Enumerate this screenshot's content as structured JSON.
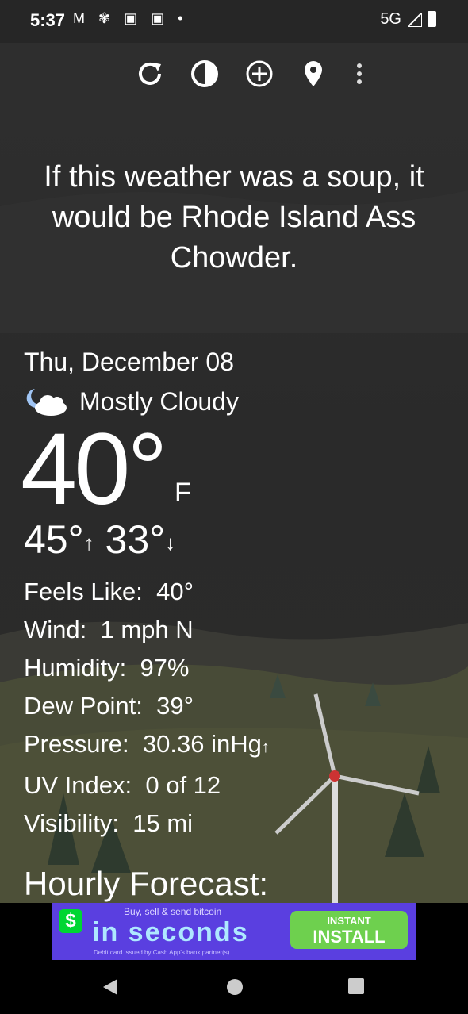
{
  "status": {
    "time": "5:37",
    "notif_icons": "M ✾ ▣ ▣ •",
    "network": "5G"
  },
  "toolbar": {
    "icons": [
      "refresh-icon",
      "theme-icon",
      "add-location-icon",
      "location-pin-icon",
      "more-vert-icon"
    ]
  },
  "headline": "If this weather was a soup, it would be Rhode Island Ass Chowder.",
  "weather": {
    "date": "Thu, December 08",
    "condition": "Mostly Cloudy",
    "temp": "40°",
    "unit": "F",
    "high": "45°",
    "low": "33°",
    "feels_like_label": "Feels Like:",
    "feels_like": "40°",
    "wind_label": "Wind:",
    "wind": "1 mph N",
    "humidity_label": "Humidity:",
    "humidity": "97%",
    "dew_point_label": "Dew Point:",
    "dew_point": "39°",
    "pressure_label": "Pressure:",
    "pressure": "30.36 inHg",
    "uv_label": "UV Index:",
    "uv": "0 of 12",
    "visibility_label": "Visibility:",
    "visibility": "15 mi"
  },
  "hourly_title": "Hourly Forecast:",
  "ad": {
    "top_text": "Buy, sell & send bitcoin",
    "main_text": "in seconds",
    "small_text": "Debit card issued by Cash App's bank partner(s).",
    "cta_top": "INSTANT",
    "cta_main": "INSTALL",
    "logo": "$"
  },
  "colors": {
    "sky": "#2b2b2b",
    "hills": "#4a4d3a",
    "ad_bg": "#5a3fe0",
    "cta": "#6ed04e"
  }
}
